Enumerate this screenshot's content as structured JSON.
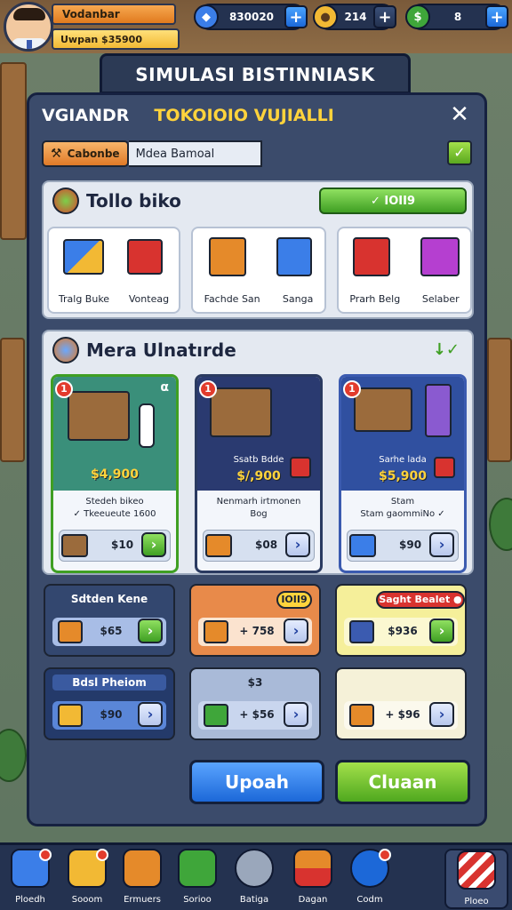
{
  "player": {
    "name": "Vodanbar",
    "level_text": "Uwpan $35900"
  },
  "resources": [
    {
      "name": "gems",
      "value": "830020",
      "icon": "gem-icon",
      "color": "#3b7ee8"
    },
    {
      "name": "gold",
      "value": "214",
      "icon": "gold-coin-icon",
      "color": "#f2b934"
    },
    {
      "name": "cash",
      "value": "8",
      "icon": "cash-icon",
      "color": "#3fa63a"
    }
  ],
  "banner_title": "SIMULASI BISTINNIASK",
  "modal": {
    "tab_left": "VGIANDR",
    "tab_right": "TOKOIOIO VUJIALLI",
    "close": "✕",
    "crumb_pill": "Cabonbe",
    "crumb_text": "Mdea Bamoal",
    "crumb_check": "✓"
  },
  "top_section": {
    "title": "Tollo biko",
    "button": "✓ IOII9",
    "cards": [
      {
        "labels": [
          "Tralg Buke",
          "Vonteag"
        ]
      },
      {
        "labels": [
          "Fachde San",
          "Sanga"
        ]
      },
      {
        "labels": [
          "Prarh Belg",
          "Selaber"
        ]
      }
    ]
  },
  "mid_section": {
    "title": "Mera Ulnatırde",
    "listings": [
      {
        "badge": "1",
        "corner": "α",
        "name": "",
        "price": "$4,900",
        "desc1": "Stedeh bikeo",
        "desc2": "✓ Tkeeueute 1600",
        "amount": "$10",
        "accent": "green"
      },
      {
        "badge": "1",
        "corner": "",
        "name": "Ssatb Bdde",
        "price": "$/,900",
        "desc1": "Nenmarh irtmonen",
        "desc2": "Bog",
        "amount": "$08",
        "accent": "blue"
      },
      {
        "badge": "1",
        "corner": "",
        "name": "Sarhe lada",
        "price": "$5,900",
        "desc1": "Stam",
        "desc2": "Stam gaommiNo ✓",
        "amount": "$90",
        "accent": "blue"
      }
    ]
  },
  "tiles": [
    {
      "title": "Sdtden Kene",
      "tag": "",
      "prefix": "",
      "amount": "$65",
      "style": "navy"
    },
    {
      "title": "",
      "tag": "IOII9",
      "prefix": "+",
      "amount": "758",
      "style": "orange"
    },
    {
      "title": "",
      "tag": "Saght Bealet ●",
      "prefix": "",
      "amount": "$936",
      "style": "yellow"
    },
    {
      "title": "Bdsl Pheiom",
      "tag": "",
      "prefix": "",
      "amount": "$90",
      "style": "navy"
    },
    {
      "title": "$3",
      "tag": "",
      "prefix": "+",
      "amount": "$56",
      "style": "lightblue"
    },
    {
      "title": "",
      "tag": "",
      "prefix": "+",
      "amount": "$96",
      "style": "cream"
    }
  ],
  "buttons": {
    "left": "Upoah",
    "right": "Cluaan"
  },
  "nav": [
    {
      "label": "Ploedh",
      "icon": "blueprint-icon",
      "badge": true
    },
    {
      "label": "Sooom",
      "icon": "gold-bar-icon",
      "badge": true
    },
    {
      "label": "Ermuers",
      "icon": "coin-bag-icon",
      "badge": false
    },
    {
      "label": "Sorioo",
      "icon": "cash-stack-icon",
      "badge": false
    },
    {
      "label": "Batiga",
      "icon": "storage-icon",
      "badge": false
    },
    {
      "label": "Dagan",
      "icon": "gift-box-icon",
      "badge": false
    },
    {
      "label": "Codm",
      "icon": "globe-icon",
      "badge": true
    },
    {
      "label": "Ploeo",
      "icon": "shop-icon",
      "badge": false
    }
  ]
}
